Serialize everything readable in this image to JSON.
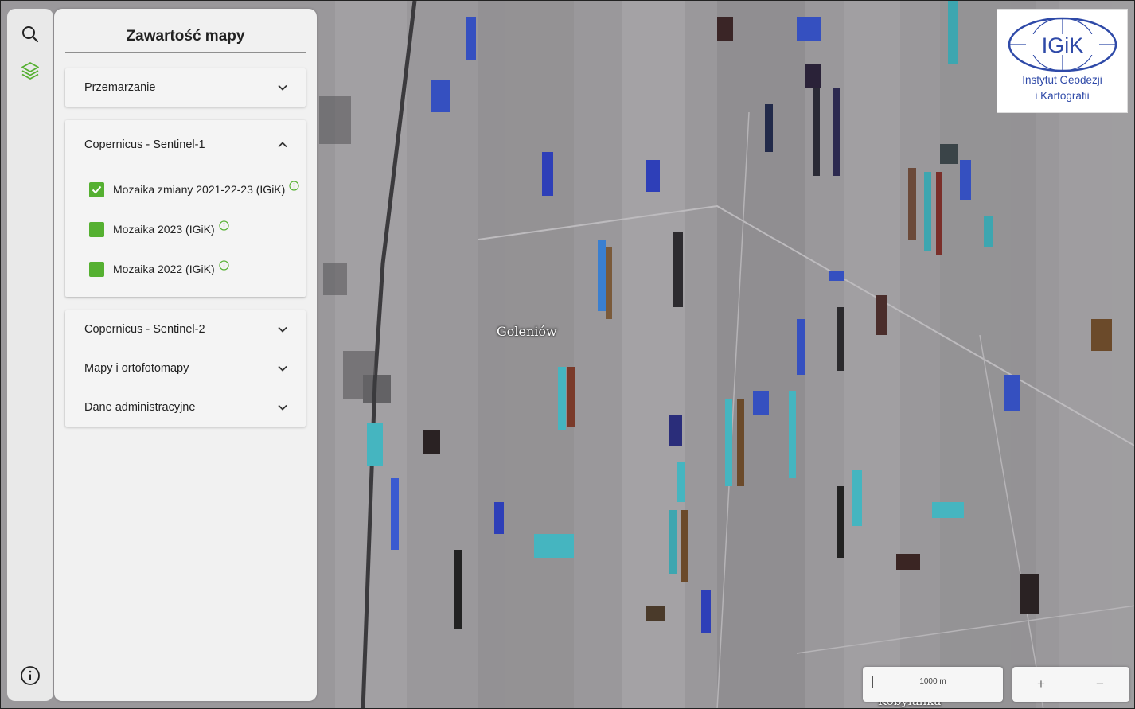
{
  "panel": {
    "title": "Zawartość mapy",
    "sections": [
      {
        "label": "Przemarzanie",
        "expanded": false
      },
      {
        "label": "Copernicus - Sentinel-1",
        "expanded": true,
        "layers": [
          {
            "label": "Mozaika zmiany 2021-22-23 (IGiK)",
            "checked": true
          },
          {
            "label": "Mozaika 2023 (IGiK)",
            "checked": false
          },
          {
            "label": "Mozaika 2022 (IGiK)",
            "checked": false
          }
        ]
      },
      {
        "label": "Copernicus - Sentinel-2",
        "expanded": false
      },
      {
        "label": "Mapy i ortofotomapy",
        "expanded": false
      },
      {
        "label": "Dane administracyjne",
        "expanded": false
      }
    ]
  },
  "logo": {
    "short": "IGiK",
    "line1": "Instytut Geodezji",
    "line2": "i Kartografii"
  },
  "map": {
    "place_labels": [
      "Goleniów",
      "Kobylanka"
    ]
  },
  "scale": {
    "label": "1000 m"
  },
  "zoom": {
    "in": "+",
    "out": "−"
  },
  "colors": {
    "accent": "#55b031",
    "logo_blue": "#2f4aa8"
  }
}
